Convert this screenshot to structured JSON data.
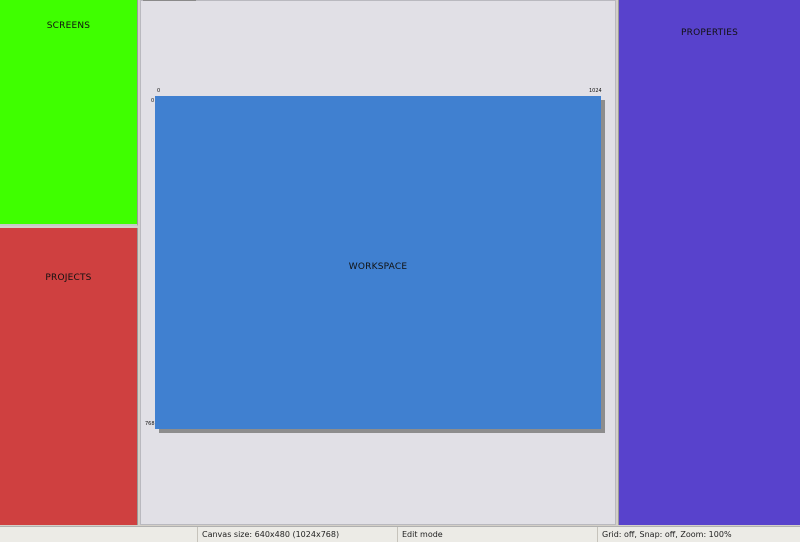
{
  "panels": {
    "screens": {
      "title": "SCREENS",
      "color": "#3fff00"
    },
    "projects": {
      "title": "PROJECTS",
      "color": "#cf4040"
    },
    "workspace": {
      "title": "WORKSPACE",
      "color": "#4080d0"
    },
    "properties": {
      "title": "PROPERTIES",
      "color": "#5842cc"
    }
  },
  "rulers": {
    "x_start": "0",
    "x_end": "1024",
    "y_start": "0",
    "y_end": "768"
  },
  "statusbar": {
    "canvas_size": "Canvas size: 640x480 (1024x768)",
    "mode": "Edit mode",
    "grid": "Grid: off, Snap: off, Zoom: 100%"
  }
}
